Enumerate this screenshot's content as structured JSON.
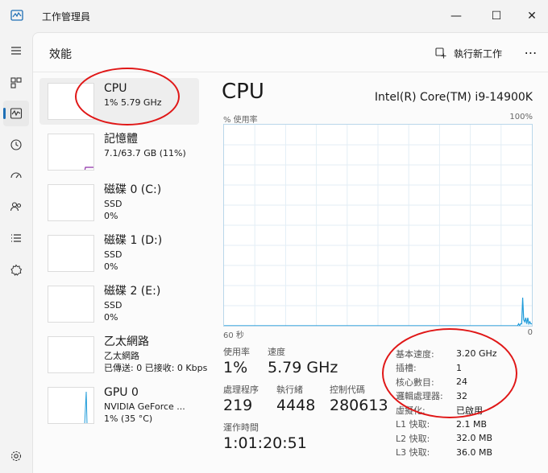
{
  "window": {
    "title": "工作管理員",
    "controls": {
      "minimize": "—",
      "maximize": "☐",
      "close": "✕"
    }
  },
  "nav": {
    "menu_icon": "hamburger-icon",
    "items": [
      {
        "id": "processes",
        "icon": "processes-icon",
        "active": false
      },
      {
        "id": "performance",
        "icon": "performance-icon",
        "active": true
      },
      {
        "id": "app-history",
        "icon": "history-icon",
        "active": false
      },
      {
        "id": "startup",
        "icon": "startup-icon",
        "active": false
      },
      {
        "id": "users",
        "icon": "users-icon",
        "active": false
      },
      {
        "id": "details",
        "icon": "details-icon",
        "active": false
      },
      {
        "id": "services",
        "icon": "services-icon",
        "active": false
      }
    ],
    "settings_icon": "gear-icon"
  },
  "header": {
    "title": "效能",
    "run_new_task": "執行新工作",
    "more": "⋯"
  },
  "resources": [
    {
      "name": "CPU",
      "sub1": "1% 5.79 GHz",
      "sub2": "",
      "sub3": ""
    },
    {
      "name": "記憶體",
      "sub1": "7.1/63.7 GB (11%)",
      "sub2": "",
      "sub3": ""
    },
    {
      "name": "磁碟 0 (C:)",
      "sub1": "SSD",
      "sub2": "0%",
      "sub3": ""
    },
    {
      "name": "磁碟 1 (D:)",
      "sub1": "SSD",
      "sub2": "0%",
      "sub3": ""
    },
    {
      "name": "磁碟 2 (E:)",
      "sub1": "SSD",
      "sub2": "0%",
      "sub3": ""
    },
    {
      "name": "乙太網路",
      "sub1": "乙太網路",
      "sub2": "已傳送: 0 已接收: 0 Kbps",
      "sub3": ""
    },
    {
      "name": "GPU 0",
      "sub1": "NVIDIA GeForce ...",
      "sub2": "1% (35 °C)",
      "sub3": ""
    }
  ],
  "detail": {
    "title": "CPU",
    "model": "Intel(R) Core(TM) i9-14900K",
    "util_label": "% 使用率",
    "util_max": "100%",
    "time_left": "60 秒",
    "time_right": "0",
    "stats": {
      "utilization": {
        "label": "使用率",
        "value": "1%"
      },
      "speed": {
        "label": "速度",
        "value": "5.79 GHz"
      },
      "processes": {
        "label": "處理程序",
        "value": "219"
      },
      "threads": {
        "label": "執行緒",
        "value": "4448"
      },
      "handles": {
        "label": "控制代碼",
        "value": "280613"
      },
      "uptime": {
        "label": "運作時間",
        "value": "1:01:20:51"
      }
    },
    "specs": [
      {
        "k": "基本速度:",
        "v": "3.20 GHz"
      },
      {
        "k": "插槽:",
        "v": "1"
      },
      {
        "k": "核心數目:",
        "v": "24"
      },
      {
        "k": "邏輯處理器:",
        "v": "32"
      },
      {
        "k": "虛擬化:",
        "v": "已啟用"
      },
      {
        "k": "L1 快取:",
        "v": "2.1 MB"
      },
      {
        "k": "L2 快取:",
        "v": "32.0 MB"
      },
      {
        "k": "L3 快取:",
        "v": "36.0 MB"
      }
    ]
  },
  "cpu_graph": {
    "ylim": [
      0,
      100
    ],
    "values": [
      0,
      0,
      0,
      0,
      0,
      0,
      0,
      0,
      0,
      0,
      0,
      0,
      0,
      0,
      0,
      0,
      0,
      0,
      0,
      0,
      0,
      0,
      0,
      0,
      0,
      0,
      0,
      0,
      0,
      0,
      0,
      0,
      0,
      0,
      0,
      0,
      0,
      0,
      0,
      0,
      0,
      0,
      0,
      0,
      0,
      0,
      0,
      0,
      0,
      0,
      0,
      0,
      0,
      0,
      0,
      0,
      0,
      0,
      0,
      0,
      0,
      0,
      0,
      0,
      0,
      0,
      0,
      0,
      0,
      0,
      0,
      0,
      0,
      0,
      0,
      0,
      0,
      0,
      0,
      0,
      0,
      0,
      0,
      0,
      0,
      0,
      0,
      0,
      0,
      0,
      0,
      0,
      0,
      0,
      0,
      0,
      0,
      0,
      0,
      0,
      0,
      0,
      0,
      0,
      0,
      0,
      0,
      0,
      0,
      0,
      0,
      0,
      0,
      0,
      0,
      0,
      0,
      0,
      0,
      0,
      0,
      0,
      0,
      0,
      0,
      0,
      0,
      0,
      0,
      0,
      0,
      0,
      0,
      0,
      0,
      0,
      0,
      0,
      0,
      0,
      0,
      0,
      0,
      0,
      0,
      0,
      0,
      0,
      0,
      0,
      0,
      0,
      0,
      0,
      0,
      0,
      0,
      0,
      0,
      0,
      0,
      0,
      0,
      0,
      0,
      0,
      0,
      0,
      0,
      0,
      0,
      0,
      0,
      0,
      0,
      0,
      0,
      0,
      0,
      0,
      0,
      0,
      0,
      0,
      0,
      0,
      0,
      0,
      0,
      0,
      0,
      0,
      0,
      0,
      0,
      0,
      0,
      0,
      0,
      0,
      0,
      0,
      0,
      0,
      0,
      0,
      0,
      0,
      0,
      0,
      0,
      0,
      0,
      0,
      0,
      0,
      0,
      0,
      0,
      0,
      0,
      0,
      0,
      0,
      0,
      0,
      0,
      0,
      0,
      0,
      0,
      0,
      0,
      0,
      0,
      0,
      0,
      0,
      0,
      0,
      0,
      0,
      0,
      0,
      0,
      0,
      0,
      0,
      0,
      0,
      0,
      0,
      0,
      0,
      0,
      0,
      0,
      0,
      0,
      0,
      0,
      0,
      0,
      0,
      0,
      0,
      0,
      0,
      0,
      0,
      0,
      0,
      0,
      0,
      0,
      0,
      0,
      0,
      0,
      0,
      0,
      0,
      0,
      0,
      0,
      0,
      0,
      0,
      1,
      0,
      1,
      1,
      14,
      3,
      2,
      4,
      1,
      4,
      1,
      2,
      1,
      1
    ]
  },
  "colors": {
    "cpu": "#1f9bd9",
    "memory": "#8e2fa8",
    "gpu": "#1f9bd9",
    "annotation": "#e01717"
  }
}
